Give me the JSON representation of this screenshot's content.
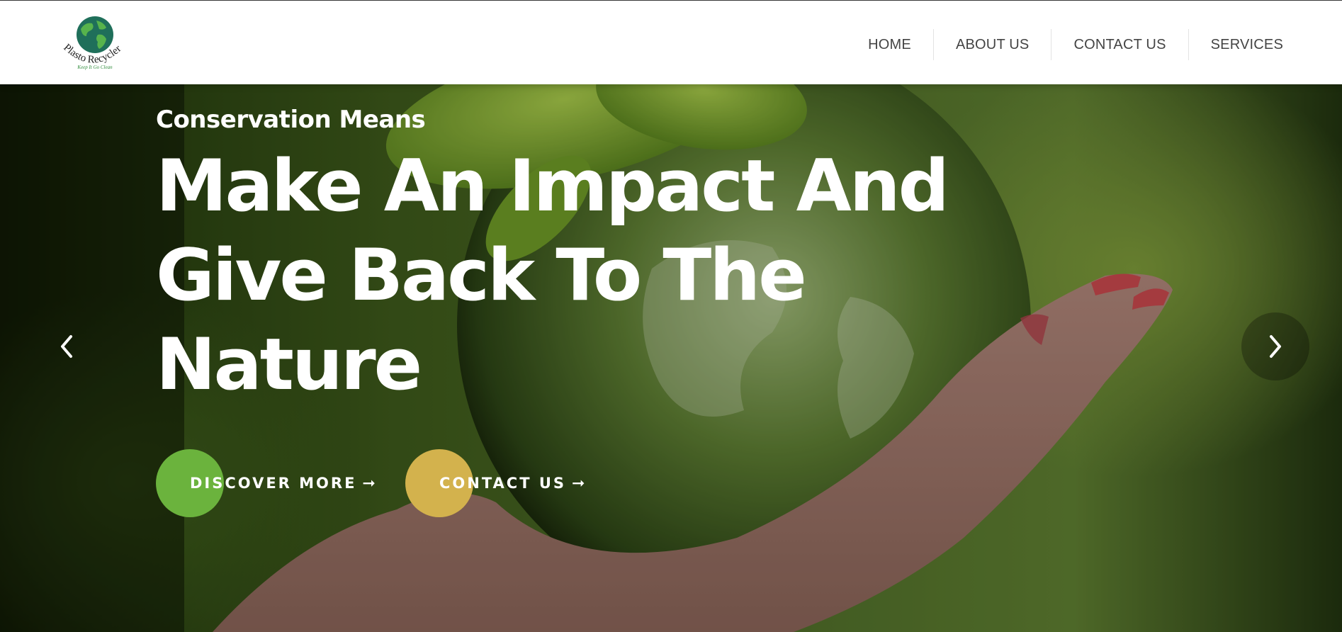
{
  "brand": {
    "logo_name": "Plasto Recycler",
    "logo_tagline": "Keep It Go Clean"
  },
  "nav": {
    "items": [
      {
        "label": "HOME"
      },
      {
        "label": "ABOUT US"
      },
      {
        "label": "CONTACT US"
      },
      {
        "label": "SERVICES"
      }
    ]
  },
  "hero": {
    "kicker": "Conservation Means",
    "headline": "Make An Impact And Give Back To The Nature",
    "buttons": {
      "discover": "DISCOVER MORE",
      "contact": "CONTACT US"
    },
    "arrow_icon": "arrow-right-icon"
  },
  "colors": {
    "discover_accent": "#6bb33d",
    "contact_accent": "#d3b24d",
    "nav_text": "#444444"
  }
}
